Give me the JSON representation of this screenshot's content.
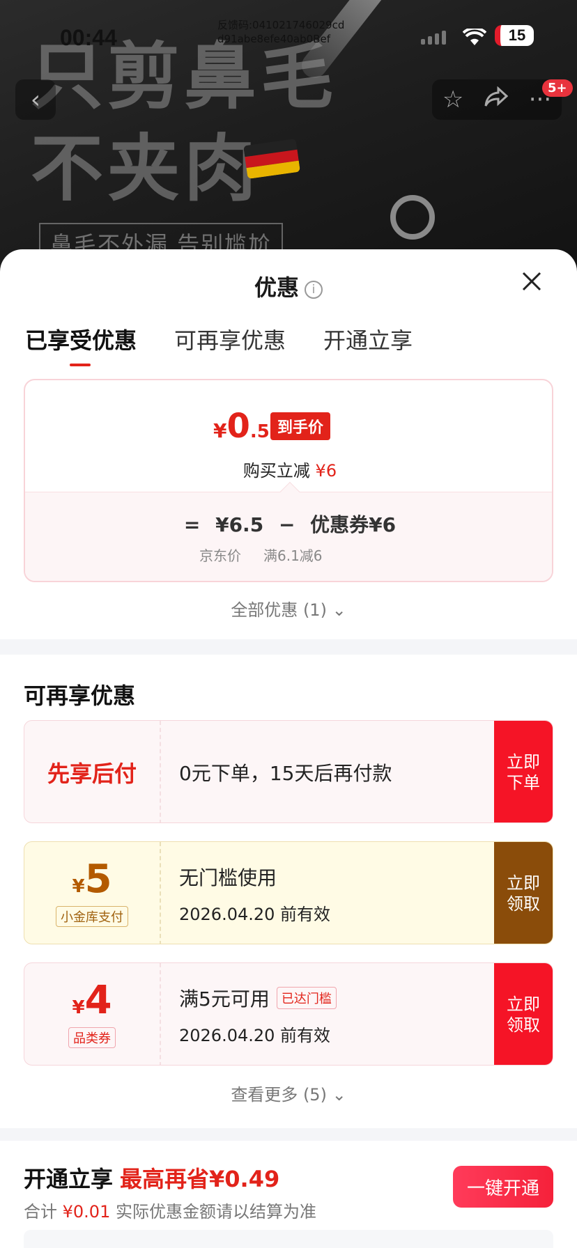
{
  "status_bar": {
    "time": "00:44",
    "feedback_code": "反馈码:041021746029cd d91abe8efe40ab0Bef",
    "battery": "15"
  },
  "hero": {
    "headline_line1": "只剪鼻毛",
    "headline_line2": "不夹肉",
    "tagline": "鼻毛不外漏 告别尴尬",
    "cart_badge": "5+"
  },
  "sheet": {
    "title": "优惠",
    "tabs": [
      {
        "label": "已享受优惠"
      },
      {
        "label": "可再享优惠"
      },
      {
        "label": "开通立享"
      }
    ],
    "final_price": {
      "currency": "¥",
      "integer": "0",
      "decimal": ".5",
      "tag": "到手价",
      "instant_cut_label": "购买立减",
      "instant_cut_value": "¥6"
    },
    "formula": {
      "equals": "=",
      "jd_price": "¥6.5",
      "minus": "−",
      "coupon": "优惠券¥6",
      "jd_price_label": "京东价",
      "coupon_label": "满6.1减6"
    },
    "all_discounts": "全部优惠 (1)",
    "more_section_title": "可再享优惠",
    "coupons": [
      {
        "left_label": "先享后付",
        "main": "0元下单，15天后再付款",
        "action": "立即\n下单"
      },
      {
        "currency": "¥",
        "amount": "5",
        "tag": "小金库支付",
        "main": "无门槛使用",
        "sub": "2026.04.20 前有效",
        "action": "立即\n领取"
      },
      {
        "currency": "¥",
        "amount": "4",
        "tag": "品类券",
        "main": "满5元可用",
        "reached": "已达门槛",
        "sub": "2026.04.20 前有效",
        "action": "立即\n领取"
      }
    ],
    "see_more": "查看更多 (5)",
    "open": {
      "title": "开通立享",
      "highlight": "最高再省¥0.49",
      "sub_prefix": "合计",
      "sub_amount": "¥0.01",
      "sub_suffix": "实际优惠金额请以结算为准",
      "button": "一键开通"
    }
  },
  "colors": {
    "accent_red": "#e2231a",
    "action_red": "#f51426",
    "gold_action": "#8a4c0a"
  },
  "icons": [
    "back-icon",
    "star-icon",
    "share-icon",
    "more-icon",
    "info-icon",
    "close-icon",
    "chevron-down-icon"
  ]
}
